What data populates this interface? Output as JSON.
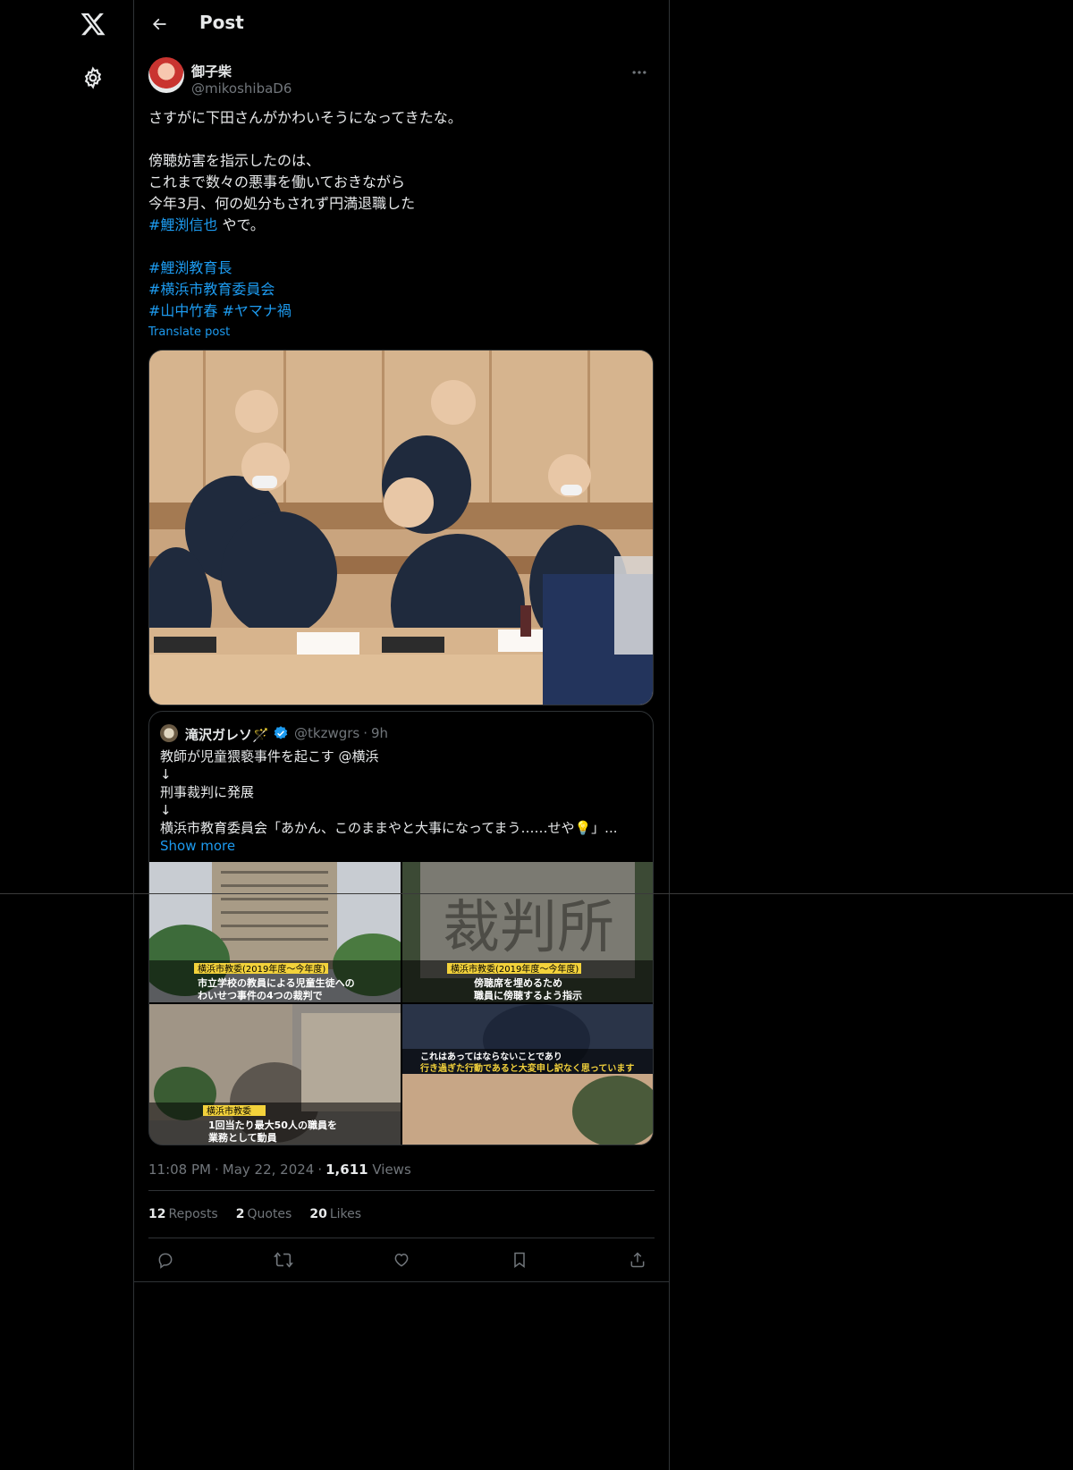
{
  "header": {
    "title": "Post",
    "back_icon": "arrow-left-icon"
  },
  "nav": {
    "logo_icon": "x-logo-icon",
    "settings_icon": "gear-icon"
  },
  "post": {
    "author_name": "御子柴",
    "author_handle": "@mikoshibaD6",
    "text_lines": [
      "さすがに下田さんがかわいそうになってきたな。",
      "",
      "傍聴妨害を指示したのは、",
      "これまで数々の悪事を働いておきながら",
      "今年3月、何の処分もされず円満退職した"
    ],
    "hashtag_1": "#鯉渕信也",
    "after_hashtag_1": " やで。",
    "hashtag_2": "#鯉渕教育長",
    "hashtag_3": "#横浜市教育委員会",
    "hashtag_4": "#山中竹春",
    "hashtag_5": "#ヤマナ禍",
    "translate": "Translate post",
    "time": "11:08 PM",
    "date": "May 22, 2024",
    "views_count": "1,611",
    "views_label": "Views",
    "reposts_count": "12",
    "reposts_label": "Reposts",
    "quotes_count": "2",
    "quotes_label": "Quotes",
    "likes_count": "20",
    "likes_label": "Likes"
  },
  "quote": {
    "name": "滝沢ガレソ🪄",
    "handle": "@tkzwgrs",
    "time": "9h",
    "lines": [
      "教師が児童猥褻事件を起こす @横浜",
      "↓",
      "刑事裁判に発展",
      "↓",
      "横浜市教育委員会「あかん、このままやと大事になってまう……せや💡」..."
    ],
    "show_more": "Show more",
    "images": [
      {
        "caption_tag": "横浜市教委(2019年度～今年度)",
        "caption": [
          "市立学校の教員による児童生徒への",
          "わいせつ事件の4つの裁判で"
        ]
      },
      {
        "caption_tag": "横浜市教委(2019年度～今年度)",
        "caption": [
          "傍聴席を埋めるため",
          "職員に傍聴するよう指示"
        ],
        "sign": "裁判所"
      },
      {
        "caption_tag": "横浜市教委",
        "caption": [
          "1回当たり最大50人の職員を",
          "業務として動員"
        ]
      },
      {
        "caption_tag": "",
        "caption": [
          "これはあってはならないことであり",
          "行き過ぎた行動であると大変申し訳なく思っています"
        ]
      }
    ]
  },
  "colors": {
    "accent": "#1d9bf0",
    "text": "#e7e9ea",
    "muted": "#71767b",
    "border": "#2f3336",
    "bg": "#000000"
  }
}
